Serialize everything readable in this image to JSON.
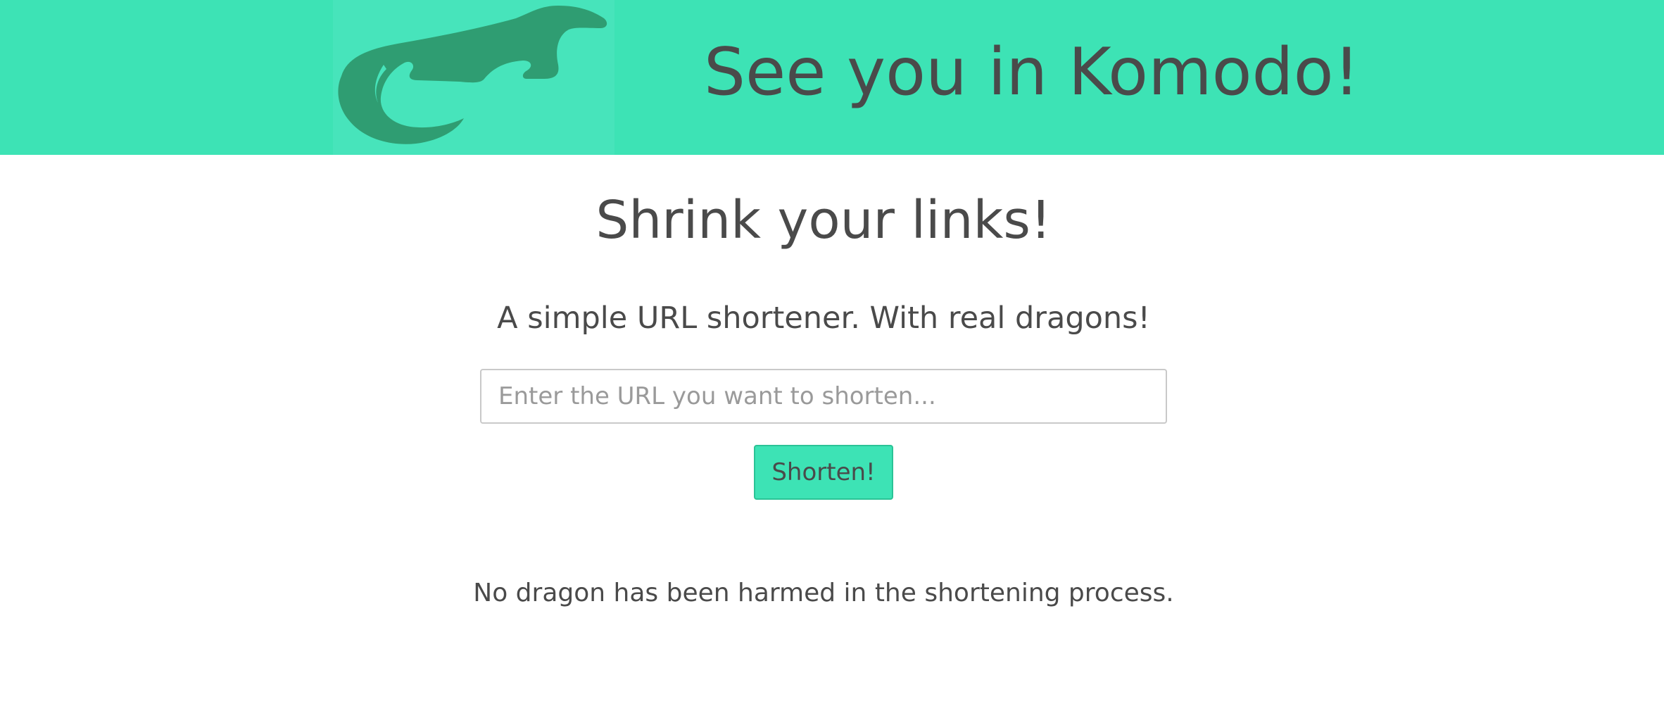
{
  "header": {
    "title": "See you in Komodo!",
    "logo_icon": "komodo-dragon-icon"
  },
  "main": {
    "title": "Shrink your links!",
    "subtitle": "A simple URL shortener. With real dragons!",
    "url_input": {
      "value": "",
      "placeholder": "Enter the URL you want to shorten..."
    },
    "shorten_label": "Shorten!",
    "footer_note": "No dragon has been harmed in the shortening process."
  },
  "colors": {
    "header_bg": "#3de3b5",
    "logo_bg": "#47e4bb",
    "logo_fg": "#2f9d72",
    "text": "#4a4a4a",
    "button_bg": "#3de3b5",
    "button_border": "#2bc396"
  }
}
